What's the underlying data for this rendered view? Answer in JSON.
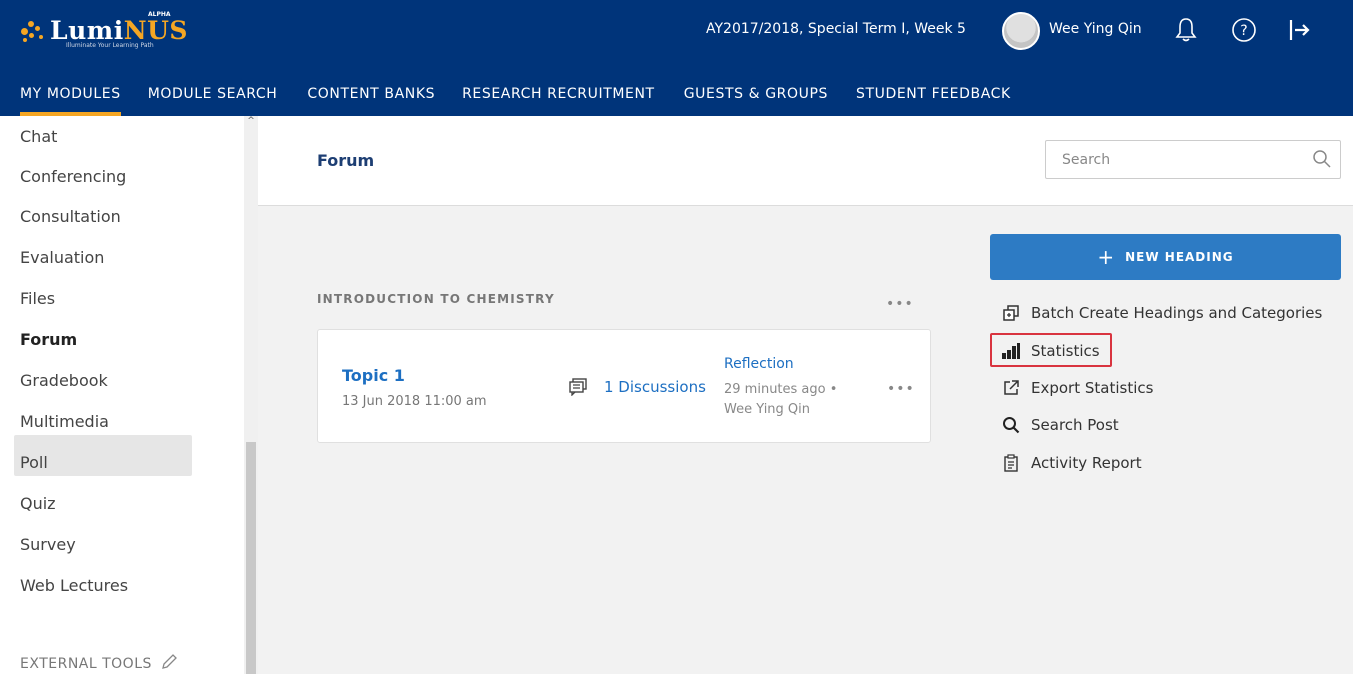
{
  "app": {
    "logo_prefix": "Lumi",
    "logo_suffix": "NUS",
    "logo_tagline": "Illuminate Your Learning Path",
    "logo_badge": "ALPHA",
    "term": "AY2017/2018, Special Term I, Week 5",
    "user_name": "Wee Ying Qin",
    "accent_color": "#f5a623",
    "header_color": "#00347a"
  },
  "nav": {
    "items": [
      {
        "label": "MY MODULES"
      },
      {
        "label": "MODULE SEARCH"
      },
      {
        "label": "CONTENT BANKS"
      },
      {
        "label": "RESEARCH RECRUITMENT"
      },
      {
        "label": "GUESTS & GROUPS"
      },
      {
        "label": "STUDENT FEEDBACK"
      }
    ]
  },
  "sidebar": {
    "items": [
      {
        "label": "Chat"
      },
      {
        "label": "Conferencing"
      },
      {
        "label": "Consultation"
      },
      {
        "label": "Evaluation"
      },
      {
        "label": "Files"
      },
      {
        "label": "Forum"
      },
      {
        "label": "Gradebook"
      },
      {
        "label": "Multimedia"
      },
      {
        "label": "Poll"
      },
      {
        "label": "Quiz"
      },
      {
        "label": "Survey"
      },
      {
        "label": "Web Lectures"
      }
    ],
    "external_tools": "EXTERNAL TOOLS"
  },
  "page": {
    "title": "Forum",
    "search_placeholder": "Search"
  },
  "heading": {
    "title": "INTRODUCTION TO CHEMISTRY",
    "topic": {
      "name": "Topic 1",
      "date": "13 Jun 2018 11:00 am",
      "discussions": "1 Discussions",
      "last_title": "Reflection",
      "last_time": "29 minutes ago •",
      "last_author": "Wee Ying Qin"
    }
  },
  "actions": {
    "new_heading": "NEW HEADING",
    "items": [
      {
        "label": "Batch Create Headings and Categories",
        "icon": "batch-create-icon"
      },
      {
        "label": "Statistics",
        "icon": "statistics-icon"
      },
      {
        "label": "Export Statistics",
        "icon": "export-icon"
      },
      {
        "label": "Search Post",
        "icon": "search-post-icon"
      },
      {
        "label": "Activity Report",
        "icon": "activity-report-icon"
      }
    ]
  }
}
